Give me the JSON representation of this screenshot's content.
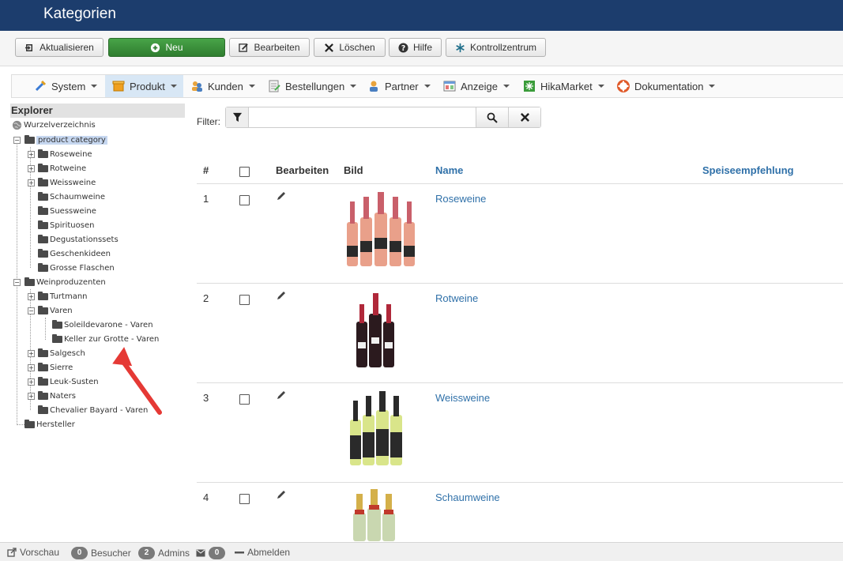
{
  "header": {
    "title": "Kategorien"
  },
  "toolbar": {
    "refresh_label": "Aktualisieren",
    "new_label": "Neu",
    "edit_label": "Bearbeiten",
    "delete_label": "Löschen",
    "help_label": "Hilfe",
    "control_center_label": "Kontrollzentrum"
  },
  "menu": {
    "items": [
      {
        "label": "System",
        "icon": "tools-icon"
      },
      {
        "label": "Produkt",
        "icon": "product-box-icon"
      },
      {
        "label": "Kunden",
        "icon": "users-icon"
      },
      {
        "label": "Bestellungen",
        "icon": "orders-icon"
      },
      {
        "label": "Partner",
        "icon": "partner-icon"
      },
      {
        "label": "Anzeige",
        "icon": "display-icon"
      },
      {
        "label": "HikaMarket",
        "icon": "hikamarket-icon"
      },
      {
        "label": "Dokumentation",
        "icon": "lifebuoy-icon"
      }
    ]
  },
  "explorer": {
    "title": "Explorer",
    "root": "Wurzelverzeichnis",
    "nodes": [
      "product category",
      "Roseweine",
      "Rotweine",
      "Weissweine",
      "Schaumweine",
      "Suessweine",
      "Spirituosen",
      "Degustationssets",
      "Geschenkideen",
      "Grosse Flaschen",
      "Weinproduzenten",
      "Turtmann",
      "Varen",
      "Soleildevarone - Varen",
      "Keller zur Grotte - Varen",
      "Salgesch",
      "Sierre",
      "Leuk-Susten",
      "Naters",
      "Chevalier Bayard - Varen",
      "Hersteller"
    ]
  },
  "filter": {
    "label": "Filter:",
    "value": ""
  },
  "table": {
    "columns": {
      "num": "#",
      "edit": "Bearbeiten",
      "image": "Bild",
      "name": "Name",
      "pairing": "Speiseempfehlung"
    },
    "rows": [
      {
        "num": "1",
        "name": "Roseweine"
      },
      {
        "num": "2",
        "name": "Rotweine"
      },
      {
        "num": "3",
        "name": "Weissweine"
      },
      {
        "num": "4",
        "name": "Schaumweine"
      }
    ]
  },
  "statusbar": {
    "preview_label": "Vorschau",
    "visitors_count": "0",
    "visitors_label": "Besucher",
    "admins_count": "2",
    "admins_label": "Admins",
    "messages_count": "0",
    "logout_label": "Abmelden"
  },
  "colors": {
    "header": "#1c3d6d",
    "new_button": "#3a8f3a",
    "link": "#3071a9",
    "annotation_arrow": "#e53935"
  }
}
